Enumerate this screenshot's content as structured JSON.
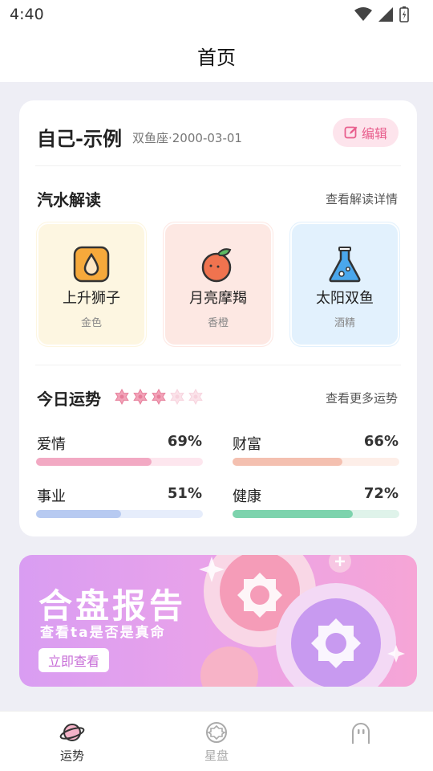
{
  "status_bar": {
    "time": "4:40"
  },
  "header": {
    "title": "首页"
  },
  "profile": {
    "name": "自己-示例",
    "detail": "双鱼座·2000-03-01",
    "edit_label": "编辑"
  },
  "reading": {
    "title": "汽水解读",
    "link": "查看解读详情",
    "tiles": [
      {
        "name": "上升狮子",
        "sub": "金色",
        "icon": "oil-drop-icon",
        "bg": "#fdf6e1"
      },
      {
        "name": "月亮摩羯",
        "sub": "香橙",
        "icon": "orange-icon",
        "bg": "#fde8e3"
      },
      {
        "name": "太阳双鱼",
        "sub": "酒精",
        "icon": "flask-icon",
        "bg": "#e2f1fd"
      }
    ]
  },
  "fortune": {
    "title": "今日运势",
    "link": "查看更多运势",
    "stars_filled": 3,
    "stars_total": 5,
    "metrics": [
      {
        "label": "爱情",
        "value": "69%",
        "fraction": 0.69,
        "color": "#f2a9c3",
        "track": "#fde6ee"
      },
      {
        "label": "财富",
        "value": "66%",
        "fraction": 0.66,
        "color": "#f4c0b0",
        "track": "#fdeee8"
      },
      {
        "label": "事业",
        "value": "51%",
        "fraction": 0.51,
        "color": "#b7caf1",
        "track": "#e6edfb"
      },
      {
        "label": "健康",
        "value": "72%",
        "fraction": 0.72,
        "color": "#7dd3ad",
        "track": "#dff3ea"
      }
    ]
  },
  "banner": {
    "title": "合盘报告",
    "subtitle": "查看ta是否是真命",
    "button": "立即查看"
  },
  "tab_bar": {
    "tabs": [
      {
        "label": "运势",
        "icon": "planet-icon",
        "active": true
      },
      {
        "label": "星盘",
        "icon": "chart-wheel-icon",
        "active": false
      },
      {
        "label": "",
        "icon": "ghost-icon",
        "active": false
      }
    ]
  },
  "colors": {
    "accent": "#e85d8c",
    "active_tab": "#333333",
    "inactive_tab": "#aaaaaa"
  }
}
